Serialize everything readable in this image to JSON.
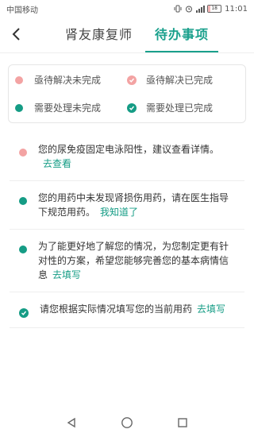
{
  "status": {
    "carrier": "中国移动",
    "time": "11:01",
    "battery": "18",
    "battery_level": 0.18
  },
  "nav": {
    "tabs": [
      {
        "label": "肾友康复师"
      },
      {
        "label": "待办事项"
      }
    ]
  },
  "legend": {
    "items": [
      {
        "label": "亟待解决未完成"
      },
      {
        "label": "亟待解决已完成"
      },
      {
        "label": "需要处理未完成"
      },
      {
        "label": "需要处理已完成"
      }
    ]
  },
  "tasks": [
    {
      "text": "您的尿免疫固定电泳阳性，建议查看详情。",
      "link": "去查看"
    },
    {
      "text": "您的用药中未发现肾损伤用药，请在医生指导下规范用药。",
      "link": "我知道了"
    },
    {
      "text": "为了能更好地了解您的情况，为您制定更有针对性的方案，希望您能够完善您的基本病情信息",
      "link": "去填写"
    },
    {
      "text": "请您根据实际情况填写您的当前用药",
      "link": "去填写"
    }
  ],
  "colors": {
    "accent": "#19a08c",
    "urgent": "#f3a3a3",
    "normal": "#159c85"
  },
  "icons": {
    "back": "chevron-left-icon",
    "nav_back": "triangle-back-icon",
    "home": "circle-home-icon",
    "recent": "square-recent-icon"
  }
}
